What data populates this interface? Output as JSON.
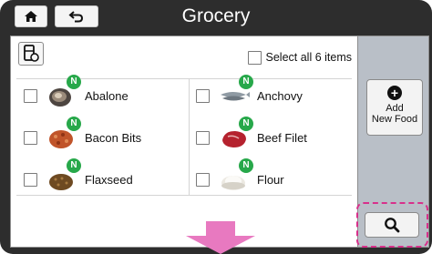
{
  "header": {
    "title": "Grocery",
    "home_icon": "home-icon",
    "back_icon": "back-arrow-icon"
  },
  "toolbar": {
    "fridge_icon": "fridge-refresh-icon",
    "select_all_label": "Select all 6 items",
    "select_all_checked": false
  },
  "items": [
    {
      "name": "Abalone",
      "badge": "N",
      "checked": false,
      "icon": "abalone-image"
    },
    {
      "name": "Anchovy",
      "badge": "N",
      "checked": false,
      "icon": "anchovy-image"
    },
    {
      "name": "Bacon Bits",
      "badge": "N",
      "checked": false,
      "icon": "bacon-bits-image"
    },
    {
      "name": "Beef Filet",
      "badge": "N",
      "checked": false,
      "icon": "beef-filet-image"
    },
    {
      "name": "Flaxseed",
      "badge": "N",
      "checked": false,
      "icon": "flaxseed-image"
    },
    {
      "name": "Flour",
      "badge": "N",
      "checked": false,
      "icon": "flour-image"
    }
  ],
  "sidebar": {
    "add_line1": "Add",
    "add_line2": "New Food",
    "add_icon": "plus-circle-icon",
    "search_icon": "search-icon"
  },
  "colors": {
    "screen_bg": "#2d2d2d",
    "sidebar_bg": "#b9bfc7",
    "badge": "#27a84a",
    "highlight": "#d8308b",
    "arrow": "#e879c0"
  }
}
